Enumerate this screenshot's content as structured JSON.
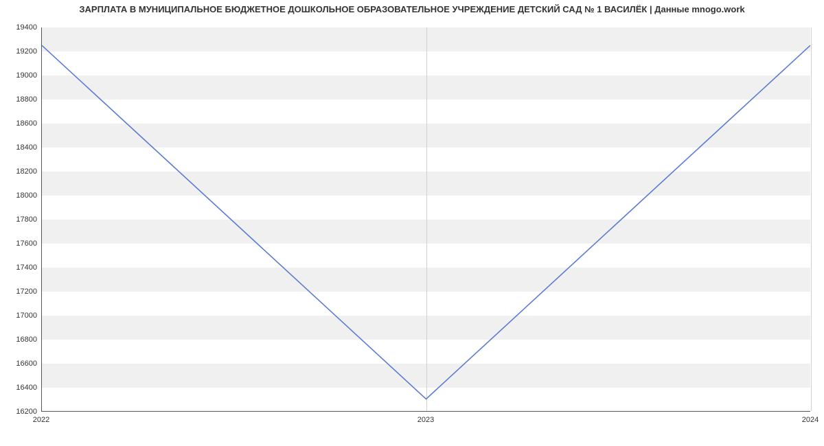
{
  "chart_data": {
    "type": "line",
    "title": "ЗАРПЛАТА В МУНИЦИПАЛЬНОЕ БЮДЖЕТНОЕ ДОШКОЛЬНОЕ ОБРАЗОВАТЕЛЬНОЕ УЧРЕЖДЕНИЕ ДЕТСКИЙ САД № 1 ВАСИЛЁК | Данные mnogo.work",
    "x": [
      2022,
      2023,
      2024
    ],
    "values": [
      19250,
      16300,
      19250
    ],
    "xticks": [
      2022,
      2023,
      2024
    ],
    "yticks": [
      16200,
      16400,
      16600,
      16800,
      17000,
      17200,
      17400,
      17600,
      17800,
      18000,
      18200,
      18400,
      18600,
      18800,
      19000,
      19200,
      19400
    ],
    "ylim": [
      16200,
      19400
    ],
    "xlim": [
      2022,
      2024
    ],
    "xlabel": "",
    "ylabel": "",
    "line_color": "#5b7bd5"
  }
}
